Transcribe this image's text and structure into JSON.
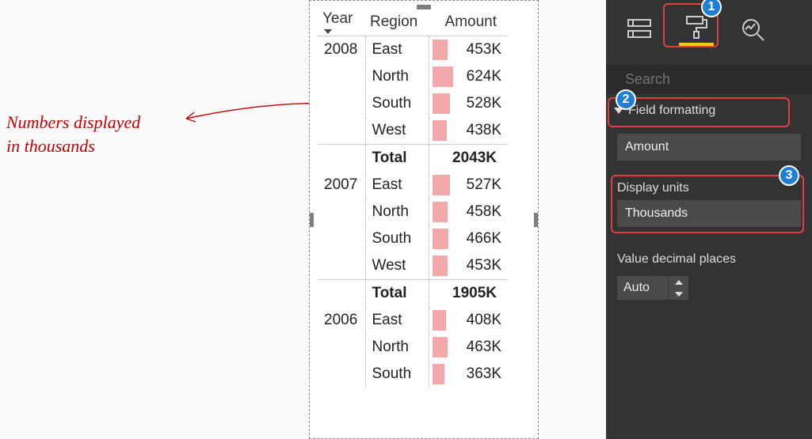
{
  "annotation": {
    "line1": "Numbers displayed",
    "line2": "in thousands"
  },
  "table": {
    "headers": {
      "year": "Year",
      "region": "Region",
      "amount": "Amount"
    },
    "max_total": 2043,
    "groups": [
      {
        "year": "2008",
        "rows": [
          {
            "region": "East",
            "amount": "453K",
            "val": 453
          },
          {
            "region": "North",
            "amount": "624K",
            "val": 624
          },
          {
            "region": "South",
            "amount": "528K",
            "val": 528
          },
          {
            "region": "West",
            "amount": "438K",
            "val": 438
          }
        ],
        "total_label": "Total",
        "total_amount": "2043K"
      },
      {
        "year": "2007",
        "rows": [
          {
            "region": "East",
            "amount": "527K",
            "val": 527
          },
          {
            "region": "North",
            "amount": "458K",
            "val": 458
          },
          {
            "region": "South",
            "amount": "466K",
            "val": 466
          },
          {
            "region": "West",
            "amount": "453K",
            "val": 453
          }
        ],
        "total_label": "Total",
        "total_amount": "1905K"
      },
      {
        "year": "2006",
        "rows": [
          {
            "region": "East",
            "amount": "408K",
            "val": 408
          },
          {
            "region": "North",
            "amount": "463K",
            "val": 463
          },
          {
            "region": "South",
            "amount": "363K",
            "val": 363
          }
        ],
        "total_label": "",
        "total_amount": ""
      }
    ]
  },
  "format_pane": {
    "search_placeholder": "Search",
    "section_title": "Field formatting",
    "field_selected": "Amount",
    "display_units_label": "Display units",
    "display_units_value": "Thousands",
    "decimal_label": "Value decimal places",
    "decimal_value": "Auto"
  },
  "callouts": {
    "c1": "1",
    "c2": "2",
    "c3": "3"
  },
  "chart_data": {
    "type": "table",
    "title": "",
    "columns": [
      "Year",
      "Region",
      "Amount"
    ],
    "rows": [
      [
        "2008",
        "East",
        453
      ],
      [
        "2008",
        "North",
        624
      ],
      [
        "2008",
        "South",
        528
      ],
      [
        "2008",
        "West",
        438
      ],
      [
        "2007",
        "East",
        527
      ],
      [
        "2007",
        "North",
        458
      ],
      [
        "2007",
        "South",
        466
      ],
      [
        "2007",
        "West",
        453
      ],
      [
        "2006",
        "East",
        408
      ],
      [
        "2006",
        "North",
        463
      ],
      [
        "2006",
        "South",
        363
      ]
    ],
    "totals": {
      "2008": 2043,
      "2007": 1905
    },
    "units": "K (thousands)"
  }
}
